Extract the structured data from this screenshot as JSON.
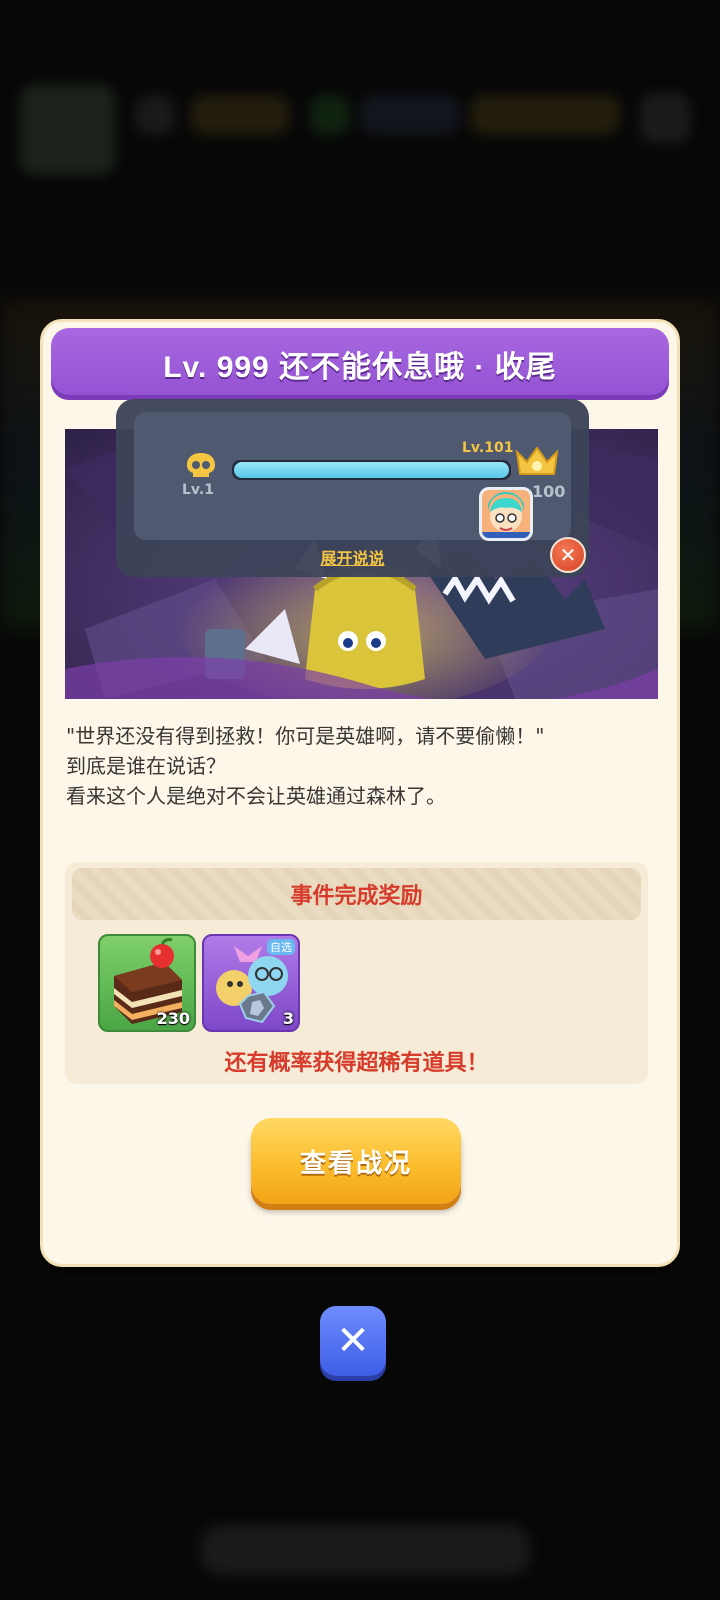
{
  "dialog": {
    "title": "Lv. 999 还不能休息哦 · 收尾",
    "progress": {
      "min_label": "Lv.1",
      "current_label": "Lv.101",
      "max_label": "100",
      "fill_fraction": 1.0,
      "expand_link": "展开说说",
      "close_icon": "close-icon"
    },
    "story_lines": [
      "\"世界还没有得到拯救！你可是英雄啊，请不要偷懒！\"",
      "到底是谁在说话？",
      "看来这个人是绝对不会让英雄通过森林了。"
    ],
    "rewards": {
      "title": "事件完成奖励",
      "items": [
        {
          "icon": "cake-icon",
          "quantity": "230"
        },
        {
          "icon": "hero-pack-icon",
          "tag": "自选",
          "quantity": "3"
        }
      ],
      "rare_note": "还有概率获得超稀有道具！"
    },
    "view_button": "查看战况"
  },
  "close_button_icon": "close-icon",
  "colors": {
    "title_purple": "#9a56d6",
    "reward_red": "#d63b2b",
    "button_yellow": "#fbbd2d",
    "close_blue": "#4f6df0"
  }
}
